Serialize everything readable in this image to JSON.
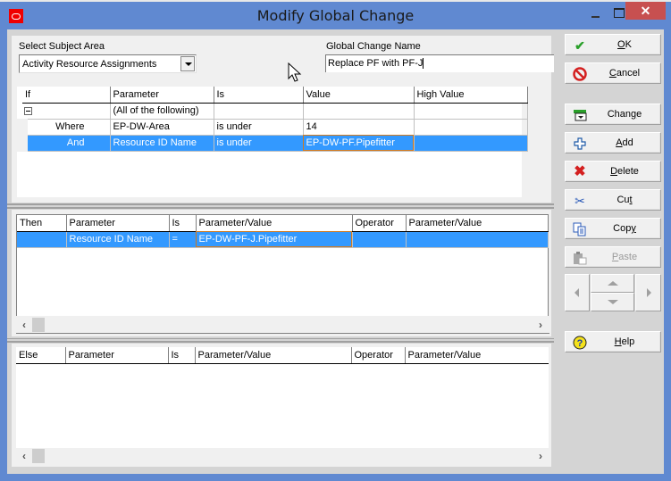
{
  "window": {
    "title": "Modify Global Change",
    "close_label": "✕"
  },
  "subject_area": {
    "label": "Select Subject Area",
    "selected": "Activity Resource Assignments"
  },
  "global_change_name": {
    "label": "Global Change Name",
    "value": "Replace PF with PF-J"
  },
  "if_grid": {
    "headers": [
      "If",
      "Parameter",
      "Is",
      "Value",
      "High Value"
    ],
    "rows": [
      {
        "if": "",
        "parameter": "(All of the following)",
        "is": "",
        "value": "",
        "high_value": ""
      },
      {
        "if": "Where",
        "parameter": "EP-DW-Area",
        "is": "is under",
        "value": "14",
        "high_value": ""
      },
      {
        "if": "And",
        "parameter": "Resource ID Name",
        "is": "is under",
        "value": "EP-DW-PF.Pipefitter",
        "high_value": ""
      }
    ]
  },
  "then_grid": {
    "headers": [
      "Then",
      "Parameter",
      "Is",
      "Parameter/Value",
      "Operator",
      "Parameter/Value"
    ],
    "rows": [
      {
        "then": "",
        "parameter": "Resource ID Name",
        "is": "=",
        "param_value": "EP-DW-PF-J.Pipefitter",
        "operator": "",
        "param_value2": ""
      }
    ]
  },
  "else_grid": {
    "headers": [
      "Else",
      "Parameter",
      "Is",
      "Parameter/Value",
      "Operator",
      "Parameter/Value"
    ],
    "rows": []
  },
  "buttons": {
    "ok": {
      "pre": "",
      "accel": "O",
      "post": "K"
    },
    "cancel": {
      "pre": "",
      "accel": "C",
      "post": "ancel"
    },
    "change": {
      "pre": "Chan",
      "accel": "g",
      "post": "e"
    },
    "add": {
      "pre": "",
      "accel": "A",
      "post": "dd"
    },
    "delete": {
      "pre": "",
      "accel": "D",
      "post": "elete"
    },
    "cut": {
      "pre": "Cu",
      "accel": "t",
      "post": ""
    },
    "copy": {
      "pre": "Cop",
      "accel": "y",
      "post": ""
    },
    "paste": {
      "pre": "",
      "accel": "P",
      "post": "aste",
      "disabled": true
    },
    "help": {
      "pre": "",
      "accel": "H",
      "post": "elp"
    }
  },
  "colors": {
    "title_bar": "#6089d1",
    "selection": "#3399ff",
    "close": "#c75050",
    "focus_border": "#d07a20"
  }
}
